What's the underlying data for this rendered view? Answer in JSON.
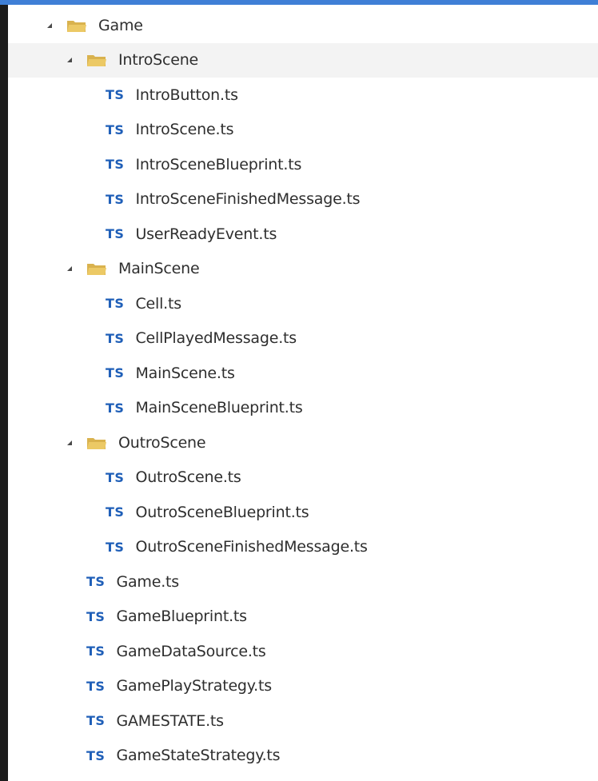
{
  "explorer": {
    "root": {
      "label": "Game",
      "folders": [
        {
          "label": "IntroScene",
          "files": [
            "IntroButton.ts",
            "IntroScene.ts",
            "IntroSceneBlueprint.ts",
            "IntroSceneFinishedMessage.ts",
            "UserReadyEvent.ts"
          ]
        },
        {
          "label": "MainScene",
          "files": [
            "Cell.ts",
            "CellPlayedMessage.ts",
            "MainScene.ts",
            "MainSceneBlueprint.ts"
          ]
        },
        {
          "label": "OutroScene",
          "files": [
            "OutroScene.ts",
            "OutroSceneBlueprint.ts",
            "OutroSceneFinishedMessage.ts"
          ]
        }
      ],
      "files": [
        "Game.ts",
        "GameBlueprint.ts",
        "GameDataSource.ts",
        "GamePlayStrategy.ts",
        "GAMESTATE.ts",
        "GameStateStrategy.ts"
      ]
    },
    "ts_badge": "TS",
    "colors": {
      "accent": "#3f7fd6",
      "ts_badge": "#1f5fb8",
      "folder": "#e8c468",
      "highlight": "#f3f3f3"
    }
  }
}
